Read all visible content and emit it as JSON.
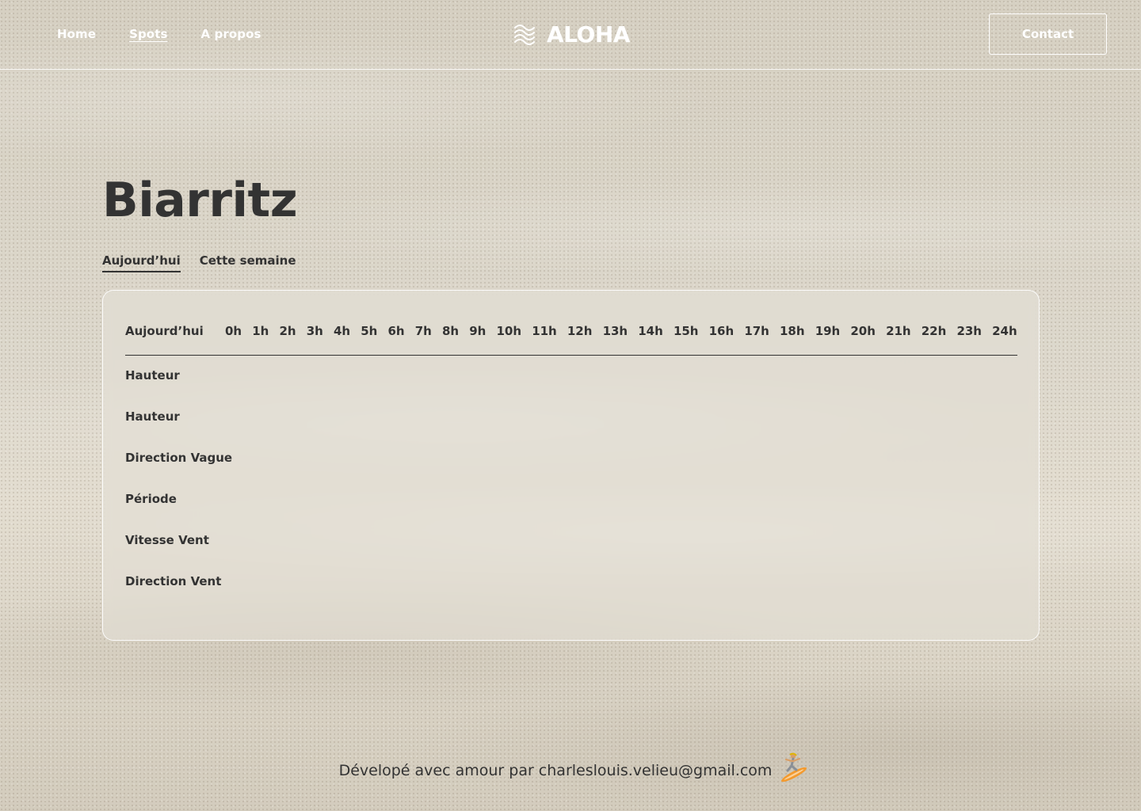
{
  "nav": {
    "items": [
      {
        "label": "Home",
        "active": false
      },
      {
        "label": "Spots",
        "active": true
      },
      {
        "label": "A propos",
        "active": false
      }
    ]
  },
  "brand": {
    "name": "ALOHA",
    "icon": "waves-icon"
  },
  "header": {
    "contact_label": "Contact"
  },
  "page": {
    "title": "Biarritz"
  },
  "tabs": [
    {
      "label": "Aujourd’hui",
      "active": true
    },
    {
      "label": "Cette semaine",
      "active": false
    }
  ],
  "forecast_table": {
    "head_label": "Aujourd’hui",
    "hours": [
      "0h",
      "1h",
      "2h",
      "3h",
      "4h",
      "5h",
      "6h",
      "7h",
      "8h",
      "9h",
      "10h",
      "11h",
      "12h",
      "13h",
      "14h",
      "15h",
      "16h",
      "17h",
      "18h",
      "19h",
      "20h",
      "21h",
      "22h",
      "23h",
      "24h"
    ],
    "rows": [
      "Hauteur",
      "Hauteur",
      "Direction Vague",
      "Période",
      "Vitesse Vent",
      "Direction Vent"
    ]
  },
  "footer": {
    "text": "Dévelopé avec amour par charleslouis.velieu@gmail.com",
    "icon": "surfer-icon"
  },
  "colors": {
    "text": "#333333",
    "header_text": "#ffffff",
    "surfboard": "#f39a2e"
  }
}
